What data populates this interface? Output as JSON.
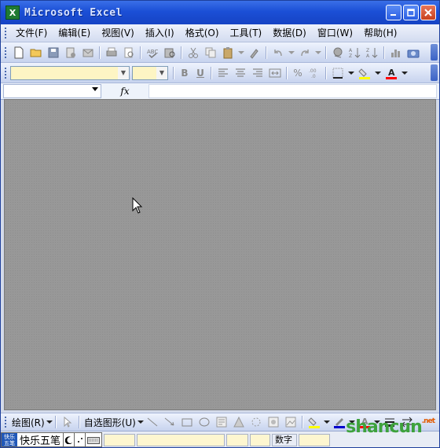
{
  "window": {
    "title": "Microsoft Excel",
    "app_icon_letter": "X"
  },
  "menu": {
    "items": [
      {
        "label": "文件(F)"
      },
      {
        "label": "编辑(E)"
      },
      {
        "label": "视图(V)"
      },
      {
        "label": "插入(I)"
      },
      {
        "label": "格式(O)"
      },
      {
        "label": "工具(T)"
      },
      {
        "label": "数据(D)"
      },
      {
        "label": "窗口(W)"
      },
      {
        "label": "帮助(H)"
      }
    ]
  },
  "format_toolbar": {
    "bold_label": "B",
    "underline_label": "U",
    "percent_label": "%",
    "font_color_label": "A"
  },
  "formula_bar": {
    "fx_label": "fx"
  },
  "draw_toolbar": {
    "draw_label": "绘图(R)",
    "autoshapes_label": "自选图形(U)"
  },
  "status": {
    "ime_logo_text": "快乐 五笔",
    "ime_name": "快乐五笔",
    "num_label": "数字"
  },
  "watermark": {
    "text": "shancun",
    "suffix": ".net"
  },
  "colors": {
    "title_bar": "#1b4fd6",
    "workspace": "#989898",
    "fill_color_swatch": "#ffff00",
    "font_color_swatch": "#ff0000"
  }
}
